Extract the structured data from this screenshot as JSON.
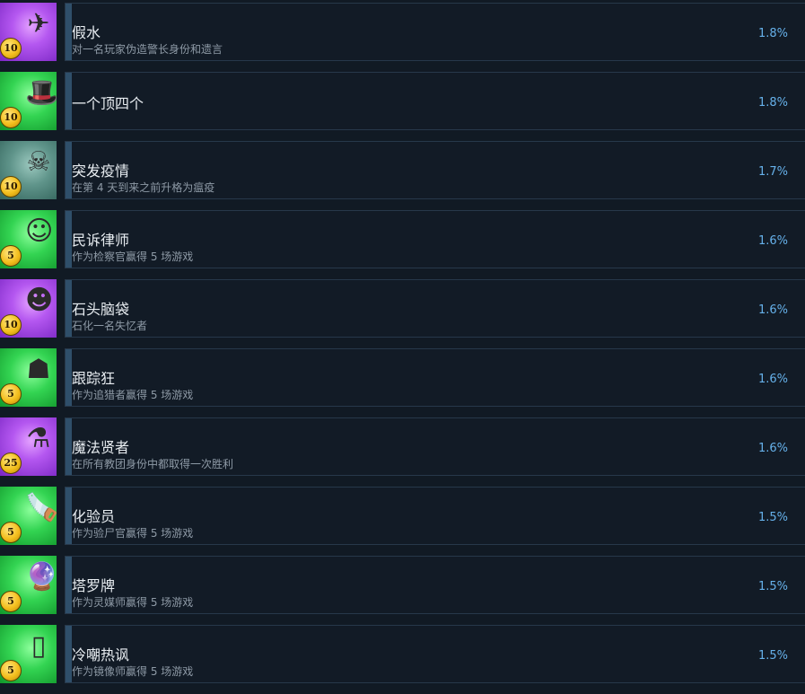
{
  "achievements": [
    {
      "title": "假水",
      "desc": "对一名玩家伪造警长身份和遗言",
      "pct": "1.8%",
      "points": "10",
      "bg": "purple",
      "icon": "paper-crane-icon",
      "glyph": "✈"
    },
    {
      "title": "一个顶四个",
      "desc": "",
      "pct": "1.8%",
      "points": "10",
      "bg": "green",
      "icon": "top-hat-icon",
      "glyph": "🎩"
    },
    {
      "title": "突发疫情",
      "desc": "在第 4 天到来之前升格为瘟疫",
      "pct": "1.7%",
      "points": "10",
      "bg": "teal",
      "icon": "plague-mask-icon",
      "glyph": "☠"
    },
    {
      "title": "民诉律师",
      "desc": "作为检察官赢得 5 场游戏",
      "pct": "1.6%",
      "points": "5",
      "bg": "green",
      "icon": "prosecutor-wig-icon",
      "glyph": "☺"
    },
    {
      "title": "石头脑袋",
      "desc": "石化一名失忆者",
      "pct": "1.6%",
      "points": "10",
      "bg": "purple",
      "icon": "medusa-head-icon",
      "glyph": "☻"
    },
    {
      "title": "跟踪狂",
      "desc": "作为追猎者赢得 5 场游戏",
      "pct": "1.6%",
      "points": "5",
      "bg": "green",
      "icon": "hooded-stalker-icon",
      "glyph": "☗"
    },
    {
      "title": "魔法贤者",
      "desc": "在所有教团身份中都取得一次胜利",
      "pct": "1.6%",
      "points": "25",
      "bg": "purple",
      "icon": "cauldron-icon",
      "glyph": "⚗"
    },
    {
      "title": "化验员",
      "desc": "作为验尸官赢得 5 场游戏",
      "pct": "1.5%",
      "points": "5",
      "bg": "green",
      "icon": "bone-saw-icon",
      "glyph": "🪚"
    },
    {
      "title": "塔罗牌",
      "desc": "作为灵媒师赢得 5 场游戏",
      "pct": "1.5%",
      "points": "5",
      "bg": "green",
      "icon": "crystal-ball-icon",
      "glyph": "🔮"
    },
    {
      "title": "冷嘲热讽",
      "desc": "作为镜像师赢得 5 场游戏",
      "pct": "1.5%",
      "points": "5",
      "bg": "green",
      "icon": "mirror-icon",
      "glyph": "▯"
    }
  ]
}
